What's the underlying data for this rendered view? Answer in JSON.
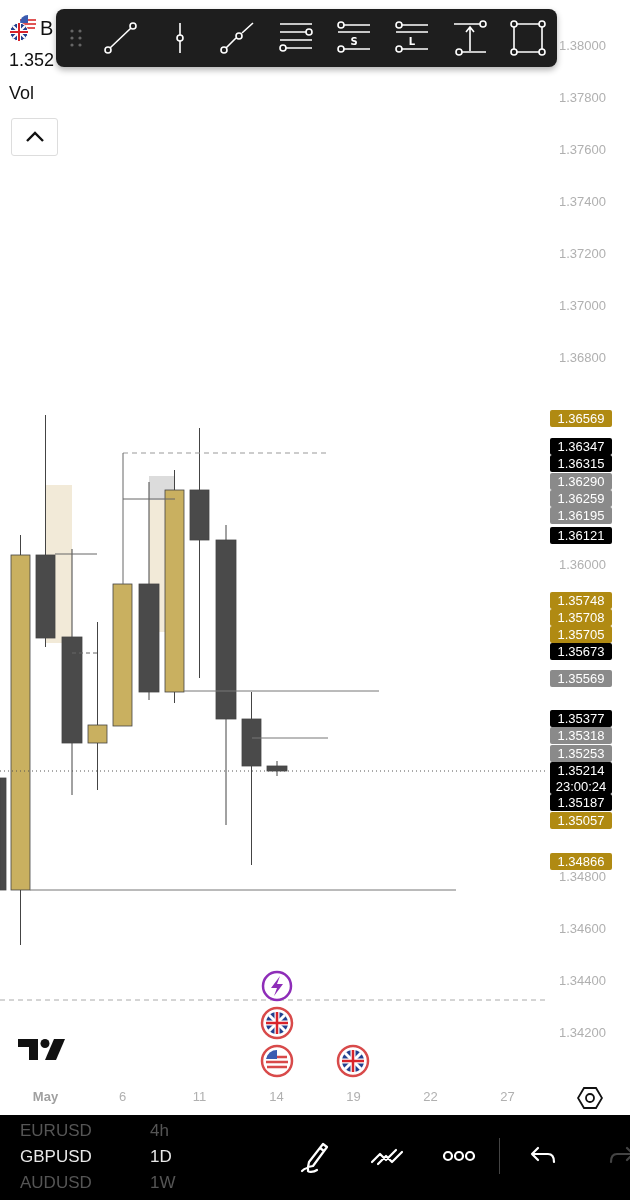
{
  "header": {
    "symbol": "B",
    "price": "1.352",
    "indicator": "Vol"
  },
  "toolbar": {
    "tools": [
      {
        "kind": "trend"
      },
      {
        "kind": "vertical"
      },
      {
        "kind": "ray"
      },
      {
        "kind": "parallel"
      },
      {
        "kind": "lettered",
        "letter": "S"
      },
      {
        "kind": "lettered",
        "letter": "L"
      },
      {
        "kind": "range"
      },
      {
        "kind": "rectangle"
      }
    ]
  },
  "price_axis": {
    "ticks": [
      "1.38000",
      "1.37800",
      "1.37600",
      "1.37400",
      "1.37200",
      "1.37000",
      "1.36800",
      "1.36000",
      "1.34800",
      "1.34600",
      "1.34400",
      "1.34200"
    ],
    "tags": [
      {
        "price": "1.36569",
        "color": "#b08a12"
      },
      {
        "price": "1.36347",
        "color": "#000000"
      },
      {
        "price": "1.36315",
        "color": "#000000"
      },
      {
        "price": "1.36290",
        "color": "#8a8a8a"
      },
      {
        "price": "1.36259",
        "color": "#8a8a8a"
      },
      {
        "price": "1.36195",
        "color": "#8a8a8a"
      },
      {
        "price": "1.36121",
        "color": "#000000"
      },
      {
        "price": "1.35748",
        "color": "#b08a12"
      },
      {
        "price": "1.35708",
        "color": "#b08a12"
      },
      {
        "price": "1.35705",
        "color": "#b08a12"
      },
      {
        "price": "1.35673",
        "color": "#000000"
      },
      {
        "price": "1.35569",
        "color": "#8a8a8a"
      },
      {
        "price": "1.35377",
        "color": "#000000"
      },
      {
        "price": "1.35318",
        "color": "#8a8a8a"
      },
      {
        "price": "1.35253",
        "color": "#8a8a8a"
      },
      {
        "price": "1.35214",
        "color": "#000000",
        "countdown": "23:00:24"
      },
      {
        "price": "1.35187",
        "color": "#000000"
      },
      {
        "price": "1.35057",
        "color": "#b08a12"
      },
      {
        "price": "1.34866",
        "color": "#b08a12"
      }
    ]
  },
  "time_axis": [
    {
      "label": "May",
      "month": true
    },
    {
      "label": "6",
      "month": false
    },
    {
      "label": "11",
      "month": false
    },
    {
      "label": "14",
      "month": false
    },
    {
      "label": "19",
      "month": false
    },
    {
      "label": "22",
      "month": false
    },
    {
      "label": "27",
      "month": false
    }
  ],
  "bottom_bar": {
    "symbols": [
      {
        "label": "EURUSD",
        "selected": false
      },
      {
        "label": "GBPUSD",
        "selected": true
      },
      {
        "label": "AUDUSD",
        "selected": false
      }
    ],
    "timeframes": [
      {
        "label": "4h",
        "selected": false
      },
      {
        "label": "1D",
        "selected": true
      },
      {
        "label": "1W",
        "selected": false
      }
    ],
    "actions": [
      {
        "kind": "draw",
        "disabled": false
      },
      {
        "kind": "patterns",
        "disabled": false
      },
      {
        "kind": "more",
        "disabled": false
      },
      {
        "kind": "undo",
        "disabled": false
      },
      {
        "kind": "redo",
        "disabled": true
      }
    ]
  }
}
